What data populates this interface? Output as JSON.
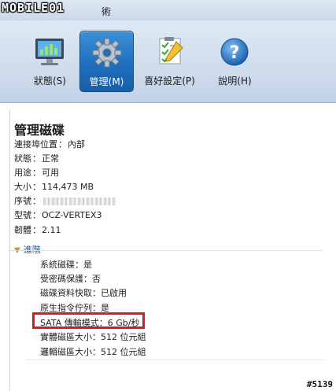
{
  "window": {
    "logo_text": "MOBILE01",
    "title_fragment": "術"
  },
  "toolbar": {
    "buttons": [
      {
        "label": "狀態(S)",
        "icon": "monitor-chart-icon",
        "active": false
      },
      {
        "label": "管理(M)",
        "icon": "gear-icon",
        "active": true
      },
      {
        "label": "喜好設定(P)",
        "icon": "checklist-icon",
        "active": false
      },
      {
        "label": "說明(H)",
        "icon": "help-question-icon",
        "active": false
      }
    ]
  },
  "panel": {
    "title": "管理磁碟",
    "fields": [
      {
        "label": "連接埠位置",
        "value": "內部"
      },
      {
        "label": "狀態",
        "value": "正常"
      },
      {
        "label": "用途",
        "value": "可用"
      },
      {
        "label": "大小",
        "value": "114,473 MB"
      },
      {
        "label": "序號",
        "value": ""
      },
      {
        "label": "型號",
        "value": "OCZ-VERTEX3"
      },
      {
        "label": "韌體",
        "value": "2.11"
      }
    ],
    "advanced_label": "進階",
    "advanced": [
      {
        "label": "系統磁碟",
        "value": "是"
      },
      {
        "label": "受密碼保護",
        "value": "否"
      },
      {
        "label": "磁碟資料快取",
        "value": "已啟用"
      },
      {
        "label": "原生指令佇列",
        "value": "是"
      },
      {
        "label": "SATA 傳輸模式",
        "value": "6 Gb/秒"
      },
      {
        "label": "實體磁區大小",
        "value": "512 位元組"
      },
      {
        "label": "邏輯磁區大小",
        "value": "512 位元組"
      }
    ],
    "highlight_color": "#d9181f"
  },
  "post_id": "#5139"
}
